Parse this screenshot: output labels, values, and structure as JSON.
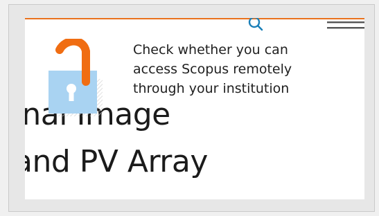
{
  "header": {
    "search_icon": "search-icon",
    "menu_icon": "hamburger-menu-icon",
    "accent_color": "#e9711c",
    "icon_color": "#1a7fb8"
  },
  "background_title": {
    "line1": "ernal Image",
    "line2": "and PV Array"
  },
  "remote_access": {
    "icon": "open-padlock-icon",
    "lines": [
      "Check whether you can",
      "access Scopus remotely",
      "through your institution"
    ],
    "lock_body_color": "#a9d3f2",
    "shackle_color": "#f06d12"
  }
}
